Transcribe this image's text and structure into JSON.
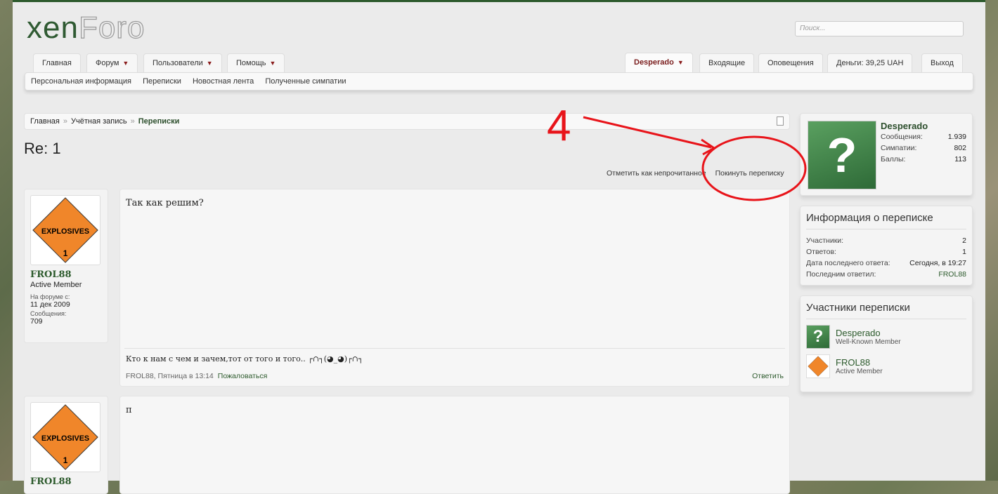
{
  "logo": {
    "part1": "xen",
    "part2": "Foro"
  },
  "search": {
    "placeholder": "Поиск..."
  },
  "nav": {
    "tabs": [
      {
        "label": "Главная"
      },
      {
        "label": "Форум"
      },
      {
        "label": "Пользователи"
      },
      {
        "label": "Помощь"
      }
    ],
    "user_tabs": [
      {
        "label": "Desperado"
      },
      {
        "label": "Входящие"
      },
      {
        "label": "Оповещения"
      },
      {
        "label": "Деньги: 39,25 UAH"
      },
      {
        "label": "Выход"
      }
    ],
    "sub": [
      {
        "label": "Персональная информация"
      },
      {
        "label": "Переписки"
      },
      {
        "label": "Новостная лента"
      },
      {
        "label": "Полученные симпатии"
      }
    ]
  },
  "breadcrumb": [
    "Главная",
    "Учётная запись",
    "Переписки"
  ],
  "title": "Re: 1",
  "actions": {
    "mark_unread": "Отметить как непрочитанное",
    "leave": "Покинуть переписку"
  },
  "posts": [
    {
      "user": "FROL88",
      "title": "Active Member",
      "joined_label": "На форуме с:",
      "joined": "11 дек 2009",
      "posts_label": "Сообщения:",
      "posts": "709",
      "text": "Так как решим?",
      "signature": "Кто к нам с чем и зачем,тот от того и того.. ┌∩┐(◕_◕)┌∩┐",
      "meta": "FROL88, Пятница в 13:14",
      "report": "Пожаловаться",
      "reply": "Ответить",
      "avatar_text": "EXPLOSIVES",
      "avatar_num": "1"
    },
    {
      "user": "FROL88",
      "text": "п",
      "avatar_text": "EXPLOSIVES",
      "avatar_num": "1"
    }
  ],
  "visitor": {
    "name": "Desperado",
    "stats": [
      {
        "label": "Сообщения:",
        "value": "1.939"
      },
      {
        "label": "Симпатии:",
        "value": "802"
      },
      {
        "label": "Баллы:",
        "value": "113"
      }
    ]
  },
  "info": {
    "heading": "Информация о переписке",
    "rows": [
      {
        "label": "Участники:",
        "value": "2"
      },
      {
        "label": "Ответов:",
        "value": "1"
      },
      {
        "label": "Дата последнего ответа:",
        "value": "Сегодня, в 19:27"
      },
      {
        "label": "Последним ответил:",
        "value": "FROL88"
      }
    ]
  },
  "participants": {
    "heading": "Участники переписки",
    "list": [
      {
        "name": "Desperado",
        "title": "Well-Known Member"
      },
      {
        "name": "FROL88",
        "title": "Active Member"
      }
    ]
  },
  "annotation": {
    "label": "4",
    "color": "#e8141a"
  }
}
